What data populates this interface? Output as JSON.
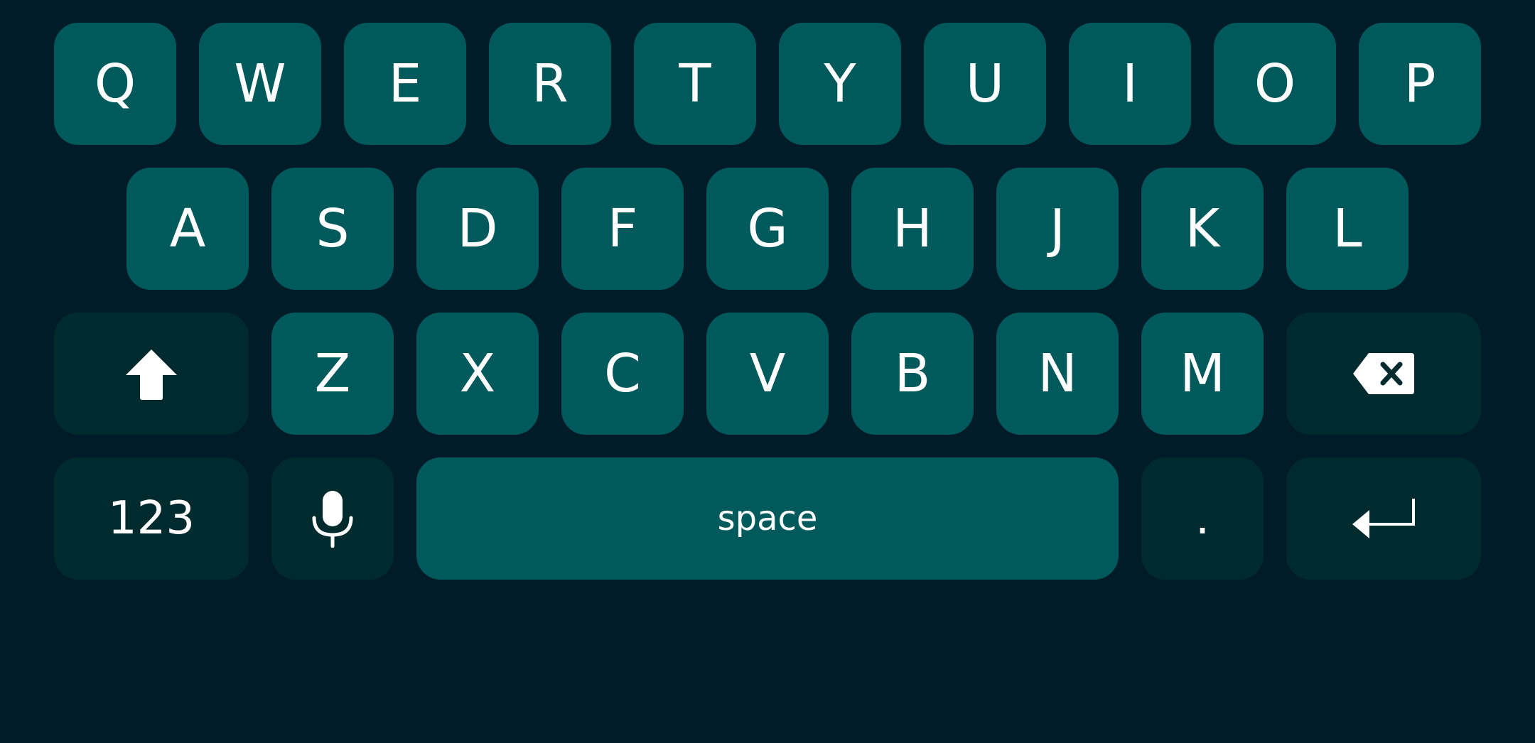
{
  "keyboard": {
    "rows": [
      [
        "Q",
        "W",
        "E",
        "R",
        "T",
        "Y",
        "U",
        "I",
        "O",
        "P"
      ],
      [
        "A",
        "S",
        "D",
        "F",
        "G",
        "H",
        "J",
        "K",
        "L"
      ],
      [
        "Z",
        "X",
        "C",
        "V",
        "B",
        "N",
        "M"
      ]
    ],
    "numbers_label": "123",
    "space_label": "space",
    "period_label": ".",
    "icons": {
      "shift": "shift-arrow-icon",
      "backspace": "backspace-icon",
      "microphone": "microphone-icon",
      "enter": "enter-return-icon"
    },
    "colors": {
      "background": "#001c28",
      "letter_key": "#005a5c",
      "function_key": "#002b2e",
      "glyph": "#ffffff"
    }
  }
}
